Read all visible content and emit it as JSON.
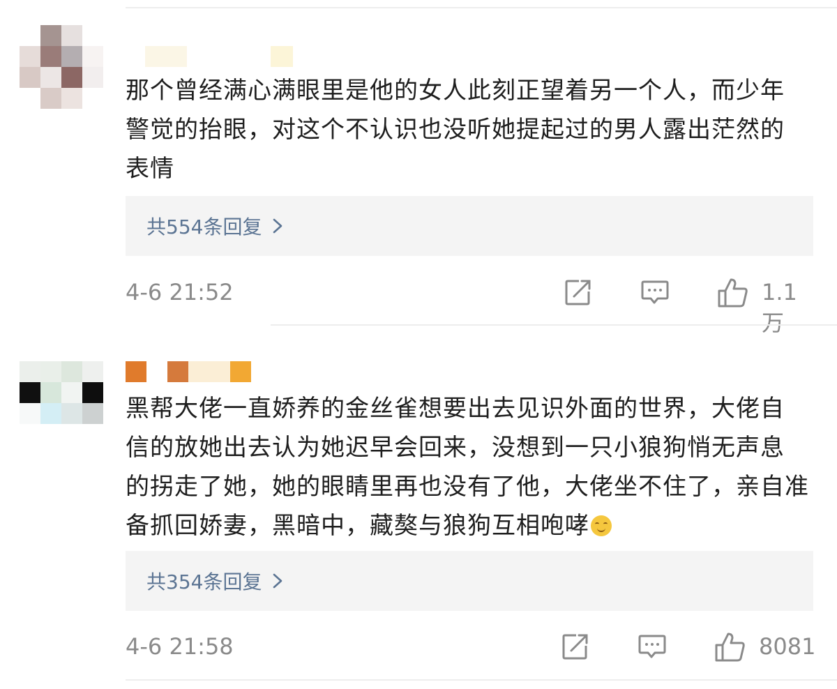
{
  "comments": [
    {
      "avatar_pixels": [
        "#ffffff",
        "#a59491",
        "#e6e0df",
        "#ffffff",
        "#e6dcd9",
        "#9a7c79",
        "#b4aeb1",
        "#f7f3f2",
        "#d8c9c5",
        "#ece6e5",
        "#8c6764",
        "#f2eeee",
        "#ffffff",
        "#d9cbc7",
        "#ece3e0",
        "#ffffff"
      ],
      "nick_colors": [
        "#fbf6e6",
        "#fbf6e6",
        "#fcf5d8"
      ],
      "text_lines": [
        "那个曾经满心满眼里是他的女人此刻正望着另一个人，而少年",
        "警觉的抬眼，对这个不认识也没听她提起过的男人露出茫然的",
        "表情"
      ],
      "replies_label": "共554条回复",
      "time": "4-6 21:52",
      "likes": "1.1万"
    },
    {
      "avatar_pixels": [
        "#ebefeb",
        "#e9efe9",
        "#dde7dd",
        "#eef0ee",
        "#101010",
        "#d7e7db",
        "#f1f4f2",
        "#0e0e0e",
        "#f7f9f9",
        "#d4eef5",
        "#dde6e6",
        "#cdd1d1",
        "#ffffff",
        "#ffffff",
        "#ffffff",
        "#ffffff"
      ],
      "nick_colors": [
        "#e07b2c",
        "#d57a3c",
        "#fbeed6",
        "#f2a833"
      ],
      "text_lines": [
        "黑帮大佬一直娇养的金丝雀想要出去见识外面的世界，大佬自",
        "信的放她出去认为她迟早会回来，没想到一只小狼狗悄无声息",
        "的拐走了她，她的眼睛里再也没有了他，大佬坐不住了，亲自准",
        "备抓回娇妻，黑暗中，藏獒与狼狗互相咆哮"
      ],
      "replies_label": "共354条回复",
      "time": "4-6 21:58",
      "likes": "8081"
    }
  ],
  "icons": {
    "repost": "repost-icon",
    "comment": "comment-icon",
    "like": "thumbs-up-icon",
    "chevron": "chevron-right-icon",
    "emoji": "smiling-face-emoji"
  },
  "colors": {
    "reply_link": "#5b7493",
    "meta_gray": "#8a8a8a",
    "reply_bg": "#f4f4f4"
  }
}
